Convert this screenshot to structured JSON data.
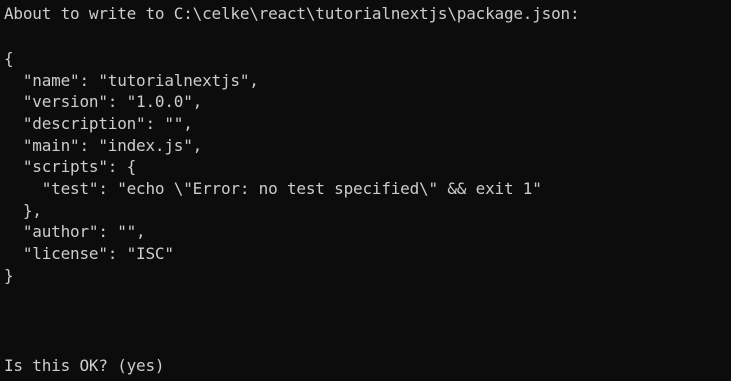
{
  "console": {
    "header": "About to write to C:\\celke\\react\\tutorialnextjs\\package.json:",
    "json_lines": [
      "{",
      "  \"name\": \"tutorialnextjs\",",
      "  \"version\": \"1.0.0\",",
      "  \"description\": \"\",",
      "  \"main\": \"index.js\",",
      "  \"scripts\": {",
      "    \"test\": \"echo \\\"Error: no test specified\\\" && exit 1\"",
      "  },",
      "  \"author\": \"\",",
      "  \"license\": \"ISC\"",
      "}"
    ],
    "prompt": "Is this OK? (yes)"
  },
  "colors": {
    "background": "#0c0c0c",
    "text": "#cccccc"
  }
}
